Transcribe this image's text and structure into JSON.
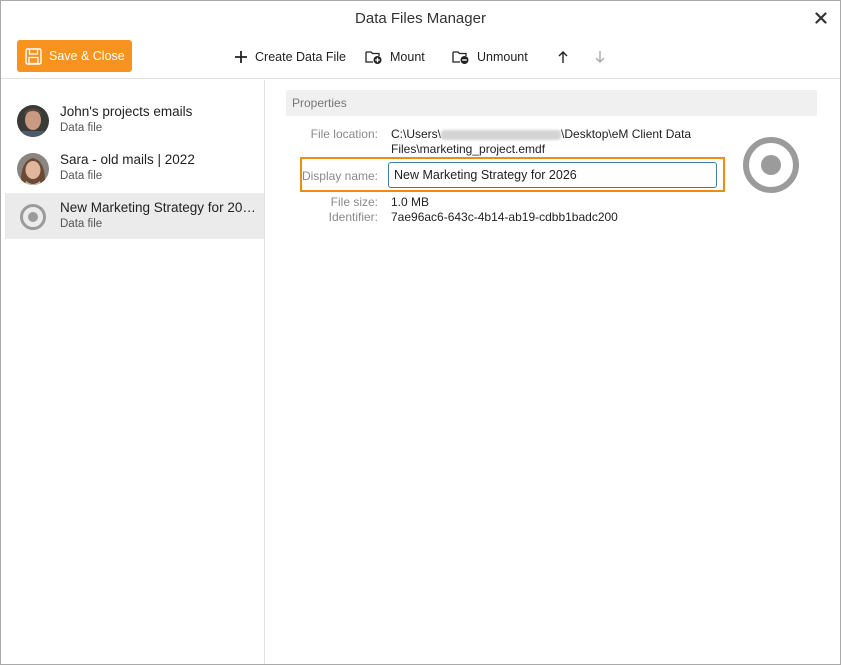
{
  "window": {
    "title": "Data Files Manager"
  },
  "toolbar": {
    "save_close_label": "Save & Close",
    "create_label": "Create Data File",
    "mount_label": "Mount",
    "unmount_label": "Unmount"
  },
  "data_files": [
    {
      "name": "John's projects emails",
      "type": "Data file"
    },
    {
      "name": "Sara - old mails | 2022",
      "type": "Data file"
    },
    {
      "name": "New Marketing Strategy for 2026",
      "type": "Data file"
    }
  ],
  "properties": {
    "header": "Properties",
    "file_location_label": "File location:",
    "file_location_prefix": "C:\\Users\\",
    "file_location_suffix": "\\Desktop\\eM Client Data",
    "file_location_line2": "Files\\marketing_project.emdf",
    "display_name_label": "Display name:",
    "display_name_value": "New Marketing Strategy for 2026",
    "file_size_label": "File size:",
    "file_size_value": "1.0 MB",
    "identifier_label": "Identifier:",
    "identifier_value": "7ae96ac6-643c-4b14-ab19-cdbb1badc200"
  },
  "colors": {
    "accent": "#f7931e",
    "highlight": "#f28c0a",
    "input_border": "#3f7e9c",
    "selected_bg": "#ebebeb"
  },
  "icons": [
    "close-icon",
    "save-icon",
    "plus-icon",
    "mount-folder-icon",
    "unmount-folder-icon",
    "arrow-up-icon",
    "arrow-down-icon",
    "target-icon"
  ]
}
